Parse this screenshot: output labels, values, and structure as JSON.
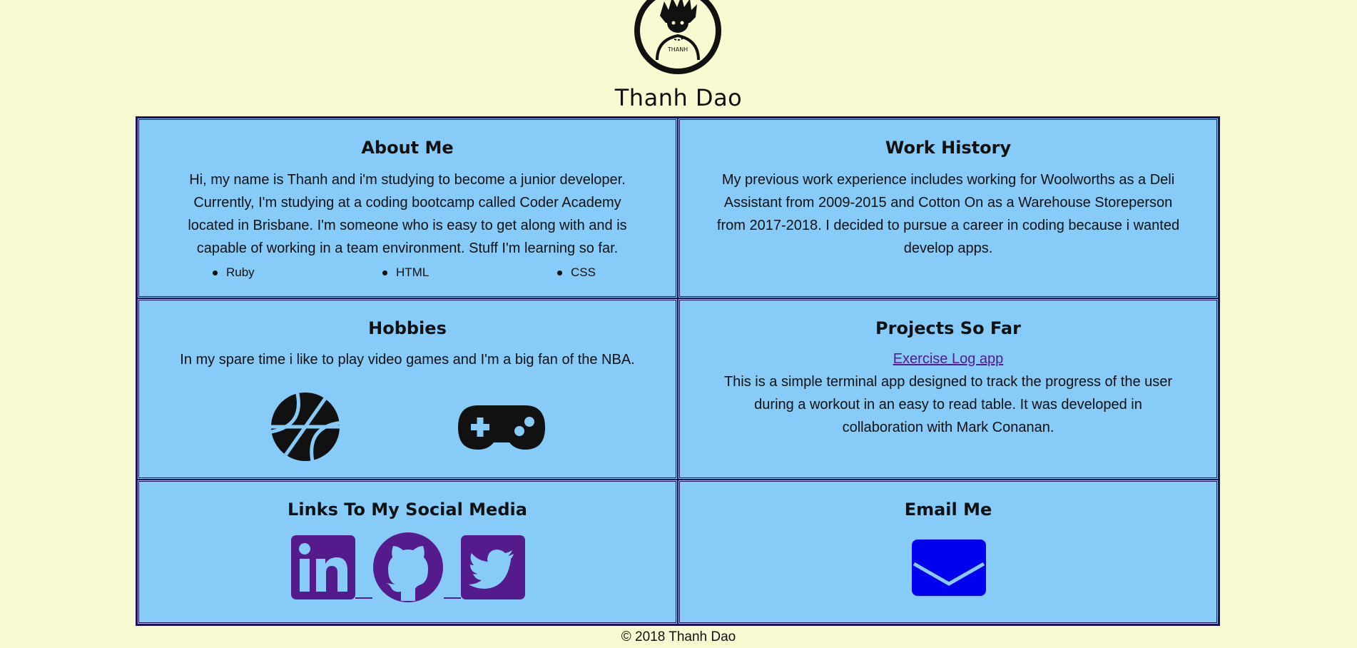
{
  "header": {
    "name": "Thanh Dao",
    "avatar_text": "THANH",
    "avatar_icon": "cartoon-avatar-icon"
  },
  "about": {
    "title": "About Me",
    "text_lines": [
      "Hi, my name is Thanh and i'm studying to become a junior developer.",
      "Currently, I'm studying at a coding bootcamp called Coder Academy",
      "located in Brisbane. I'm someone who is easy to get along with and is",
      "capable of working in a team environment. Stuff I'm learning so far."
    ],
    "skills": [
      "Ruby",
      "HTML",
      "CSS"
    ]
  },
  "work": {
    "title": "Work History",
    "text_lines": [
      "My previous work experience includes working for Woolworths as a Deli",
      "Assistant from 2009-2015 and Cotton On as a Warehouse Storeperson",
      "from 2017-2018. I decided to pursue a career in coding because i wanted",
      "develop apps."
    ]
  },
  "hobbies": {
    "title": "Hobbies",
    "text": "In my spare time i like to play video games and I'm a big fan of the NBA.",
    "icons": [
      "basketball-icon",
      "gamepad-icon"
    ]
  },
  "projects": {
    "title": "Projects So Far",
    "link_text": "Exercise Log app",
    "text_lines": [
      "This is a simple terminal app designed to track the progress of the user",
      "during a workout in an easy to read table. It was developed in",
      "collaboration with Mark Conanan."
    ]
  },
  "social": {
    "title": "Links To My Social Media",
    "icons": [
      "linkedin-icon",
      "github-icon",
      "twitter-icon"
    ],
    "color": "#551a8b"
  },
  "email": {
    "title": "Email Me",
    "icon": "envelope-icon",
    "color": "#0000ee"
  },
  "footer": {
    "text": "© 2018 Thanh Dao"
  },
  "colors": {
    "background": "#fafad2",
    "card": "#87cbf8",
    "border": "#1c1258"
  }
}
